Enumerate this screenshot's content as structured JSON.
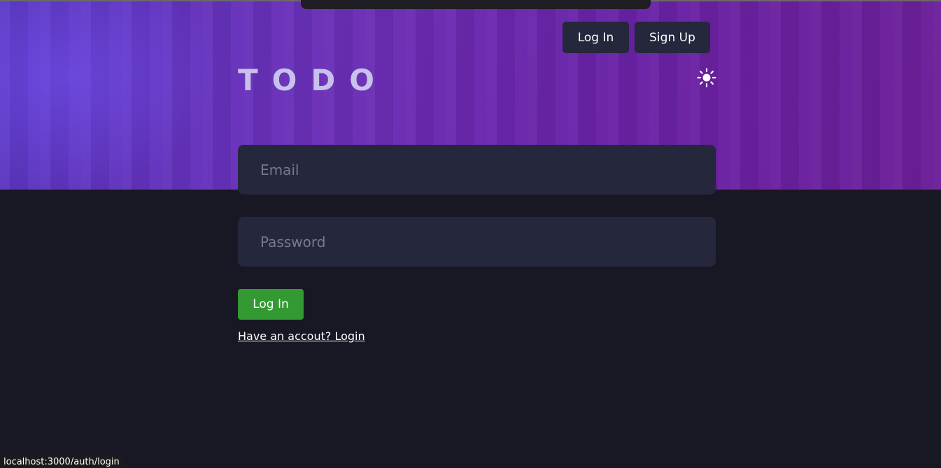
{
  "nav": {
    "login_label": "Log In",
    "signup_label": "Sign Up"
  },
  "header": {
    "logo": "TODO",
    "theme_icon": "sun-icon"
  },
  "form": {
    "email_placeholder": "Email",
    "password_placeholder": "Password",
    "submit_label": "Log In",
    "switch_link": "Have an accout? Login"
  },
  "status_bar": {
    "url": "localhost:3000/auth/login"
  },
  "colors": {
    "page_background": "#181824",
    "input_background": "#25273c",
    "submit_green": "#339933",
    "logo_color": "#c7c2ec"
  }
}
